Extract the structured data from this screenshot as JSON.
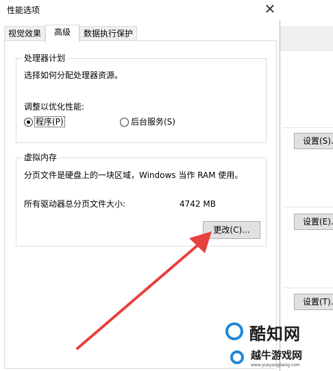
{
  "dialog": {
    "title": "性能选项",
    "close_glyph": "✕"
  },
  "tabs": [
    {
      "label": "视觉效果",
      "active": false
    },
    {
      "label": "高级",
      "active": true
    },
    {
      "label": "数据执行保护",
      "active": false
    }
  ],
  "processor_group": {
    "legend": "处理器计划",
    "description": "选择如何分配处理器资源。",
    "adjust_label": "调整以优化性能:",
    "options": [
      {
        "label": "程序(P)",
        "checked": true
      },
      {
        "label": "后台服务(S)",
        "checked": false
      }
    ]
  },
  "virtual_memory": {
    "legend": "虚拟内存",
    "description": "分页文件是硬盘上的一块区域，Windows 当作 RAM 使用。",
    "total_label": "所有驱动器总分页文件大小:",
    "total_value": "4742 MB",
    "change_button": "更改(C)..."
  },
  "background_window": {
    "buttons": [
      "设置(S)...",
      "设置(E)...",
      "设置(T)..."
    ]
  },
  "watermark": {
    "logo_text": "酷知网",
    "sub_text": "越牛游戏网",
    "url": "www.yueyangbang.com"
  },
  "colors": {
    "arrow": "#e8403c",
    "watermark_accent": "#1e88d8"
  }
}
